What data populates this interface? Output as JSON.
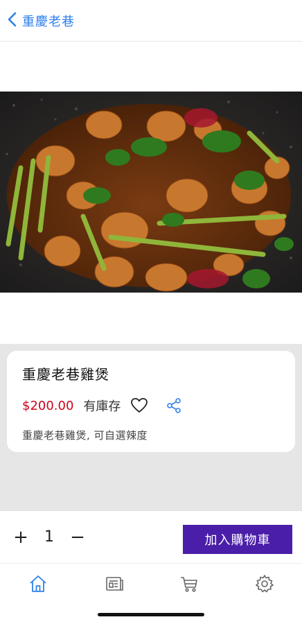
{
  "header": {
    "back_label": "重慶老巷",
    "back_icon": "chevron-left-icon",
    "accent_color": "#2f80ed"
  },
  "product": {
    "name": "重慶老巷雞煲",
    "price": "$200.00",
    "stock": "有庫存",
    "description": "重慶老巷雞煲, 可自選辣度",
    "price_color": "#d0021b",
    "photo": "chicken-hotpot-image"
  },
  "cart": {
    "plus_label": "+",
    "quantity": "1",
    "minus_label": "−",
    "add_label": "加入購物車",
    "button_color": "#4a1ea8"
  },
  "tabs": [
    {
      "icon": "home-icon",
      "active": true
    },
    {
      "icon": "news-icon",
      "active": false
    },
    {
      "icon": "cart-icon",
      "active": false
    },
    {
      "icon": "gear-icon",
      "active": false
    }
  ]
}
